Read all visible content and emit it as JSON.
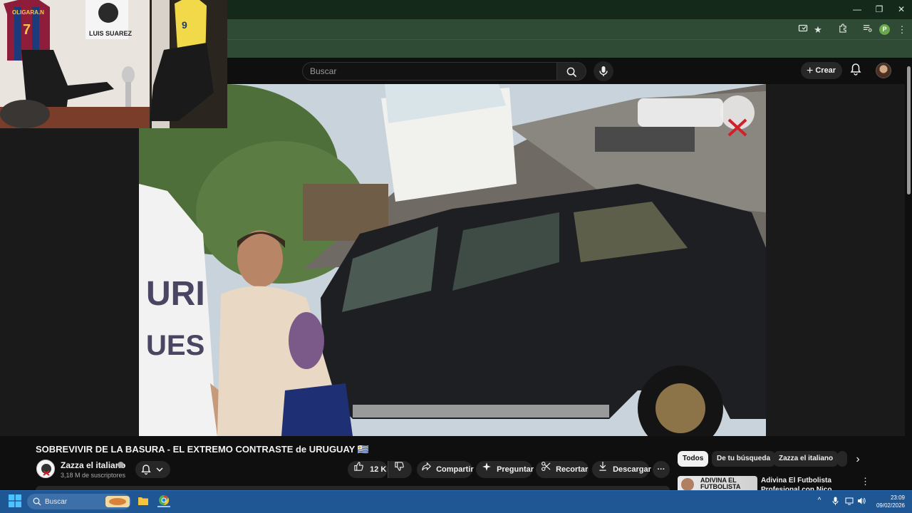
{
  "browser": {
    "window_controls": {
      "minimize": "—",
      "restore": "❐",
      "close": "✕"
    },
    "profile_initial": "P"
  },
  "youtube": {
    "search": {
      "placeholder": "Buscar"
    },
    "create_label": "Crear"
  },
  "video": {
    "title": "SOBREVIVIR DE LA BASURA - EL EXTREMO CONTRASTE de URUGUAY 🇺🇾",
    "channel_name": "Zazza el italiano",
    "subscribers": "3,18 M de suscriptores",
    "actions": {
      "likes": "12 K",
      "share": "Compartir",
      "ask": "Preguntar",
      "clip": "Recortar",
      "download": "Descargar",
      "more": "···"
    }
  },
  "sidebar": {
    "chips": [
      "Todos",
      "De tu búsqueda",
      "Zazza el italiano"
    ],
    "recommendation": {
      "thumbnail_text": "ADIVINA EL FUTBOLISTA",
      "title": "Adivina El Futbolista Profesional con Nico Williams"
    }
  },
  "taskbar": {
    "search_label": "Buscar",
    "time": "23:09",
    "date": "09/02/2026"
  },
  "webcam": {
    "poster_text": "LUIS SUAREZ",
    "jersey_text": "OLIGARA.N"
  }
}
